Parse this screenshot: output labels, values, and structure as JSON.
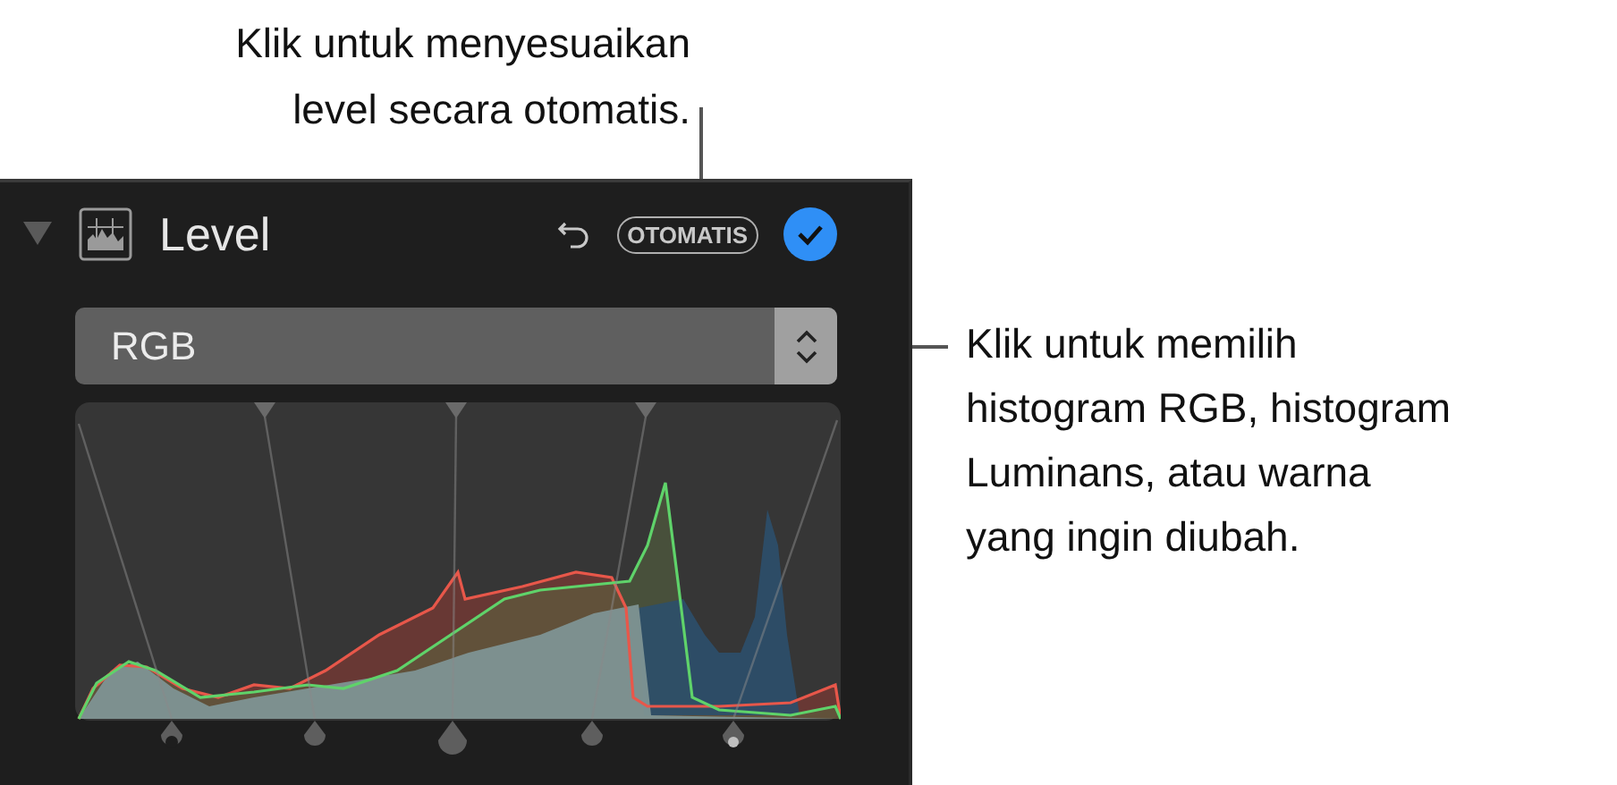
{
  "callouts": [
    {
      "kind": "top",
      "lines": [
        "Klik untuk menyesuaikan",
        "level secara otomatis."
      ]
    },
    {
      "kind": "right",
      "lines": [
        "Klik untuk memilih",
        "histogram RGB, histogram",
        "Luminans, atau warna",
        "yang ingin diubah."
      ]
    }
  ],
  "panel": {
    "title": "Level",
    "expanded": true,
    "auto_button": "OTOMATIS",
    "enabled": true,
    "dropdown": {
      "value": "RGB"
    }
  }
}
